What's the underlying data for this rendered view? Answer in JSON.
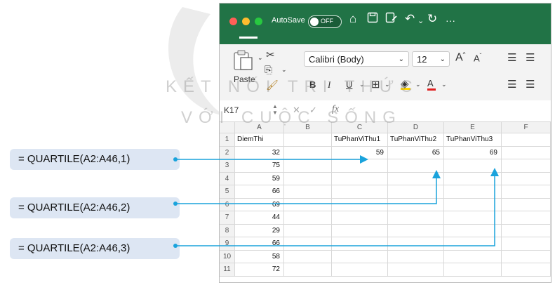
{
  "watermark": {
    "line1": "KẾT NỐI TRI THỨC",
    "line2": "VỚI CUỘC SỐNG"
  },
  "titlebar": {
    "autosave_label": "AutoSave",
    "autosave_state": "OFF",
    "more": "···"
  },
  "ribbon": {
    "paste_label": "Paste",
    "font_name": "Calibri (Body)",
    "font_size": "12",
    "bold": "B",
    "italic": "I",
    "underline": "U",
    "font_color": "A"
  },
  "formula_bar": {
    "name_box": "K17",
    "fx": "fx"
  },
  "sheet": {
    "columns": [
      "A",
      "B",
      "C",
      "D",
      "E",
      "F"
    ],
    "rows": [
      "1",
      "2",
      "3",
      "4",
      "5",
      "6",
      "7",
      "8",
      "9",
      "10",
      "11"
    ],
    "a_col": [
      "DiemThi",
      "32",
      "75",
      "59",
      "66",
      "69",
      "44",
      "29",
      "66",
      "58",
      "72"
    ],
    "headers": {
      "c": "TuPhanViThu1",
      "d": "TuPhanViThu2",
      "e": "TuPhanViThu3"
    },
    "results": {
      "c2": "59",
      "d2": "65",
      "e2": "69"
    }
  },
  "formulas": [
    "= QUARTILE(A2:A46,1)",
    "= QUARTILE(A2:A46,2)",
    "= QUARTILE(A2:A46,3)"
  ],
  "colors": {
    "excel_green": "#217346",
    "arrow": "#1aa3dc",
    "label_bg": "#dde6f3"
  }
}
